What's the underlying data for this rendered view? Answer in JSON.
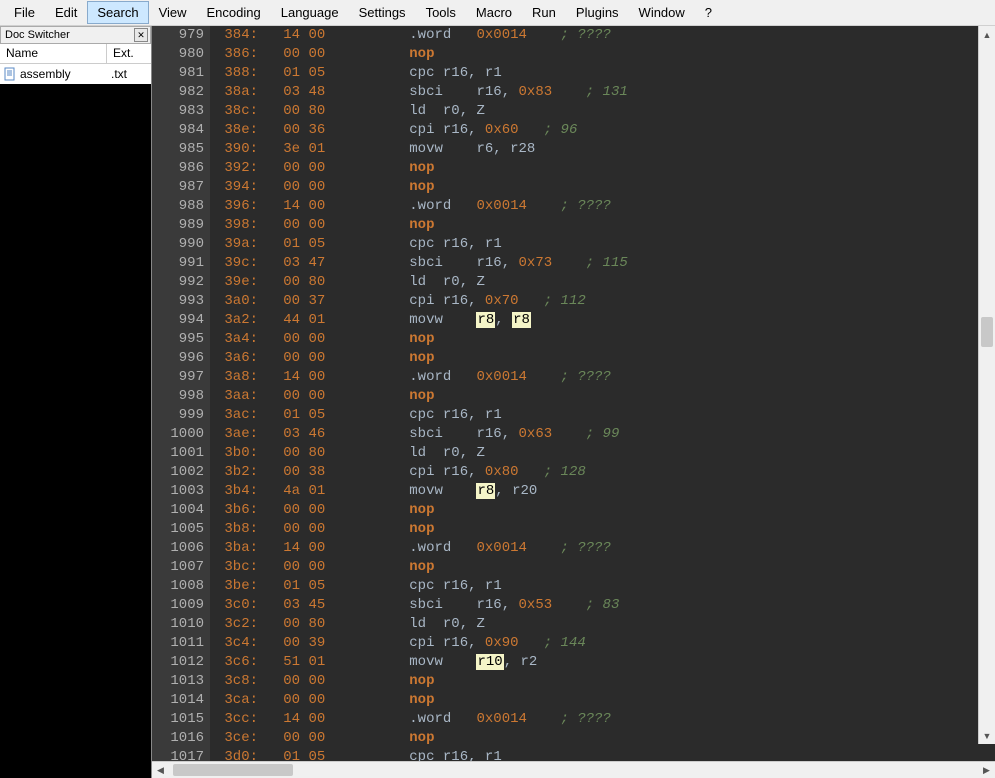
{
  "menu": [
    "File",
    "Edit",
    "Search",
    "View",
    "Encoding",
    "Language",
    "Settings",
    "Tools",
    "Macro",
    "Run",
    "Plugins",
    "Window",
    "?"
  ],
  "menu_active_index": 2,
  "doc_switcher": {
    "title": "Doc Switcher",
    "col_name": "Name",
    "col_ext": "Ext.",
    "files": [
      {
        "name": "assembly",
        "ext": ".txt"
      }
    ]
  },
  "rows": [
    {
      "ln": 979,
      "addr": "384",
      "b1": "14",
      "b2": "00",
      "instr": ".word",
      "a1": "0x0014",
      "comment": "; ????"
    },
    {
      "ln": 980,
      "addr": "386",
      "b1": "00",
      "b2": "00",
      "instr": "nop"
    },
    {
      "ln": 981,
      "addr": "388",
      "b1": "01",
      "b2": "05",
      "instr": "cpc",
      "a1": "r16,",
      "a2": "r1"
    },
    {
      "ln": 982,
      "addr": "38a",
      "b1": "03",
      "b2": "48",
      "instr": "sbci",
      "a1": "r16,",
      "a2": "0x83",
      "comment": "; 131"
    },
    {
      "ln": 983,
      "addr": "38c",
      "b1": "00",
      "b2": "80",
      "instr": "ld",
      "a1": "r0,",
      "a2": "Z"
    },
    {
      "ln": 984,
      "addr": "38e",
      "b1": "00",
      "b2": "36",
      "instr": "cpi",
      "a1": "r16,",
      "a2": "0x60",
      "comment": "; 96"
    },
    {
      "ln": 985,
      "addr": "390",
      "b1": "3e",
      "b2": "01",
      "instr": "movw",
      "a1": "r6,",
      "a2": "r28"
    },
    {
      "ln": 986,
      "addr": "392",
      "b1": "00",
      "b2": "00",
      "instr": "nop"
    },
    {
      "ln": 987,
      "addr": "394",
      "b1": "00",
      "b2": "00",
      "instr": "nop"
    },
    {
      "ln": 988,
      "addr": "396",
      "b1": "14",
      "b2": "00",
      "instr": ".word",
      "a1": "0x0014",
      "comment": "; ????"
    },
    {
      "ln": 989,
      "addr": "398",
      "b1": "00",
      "b2": "00",
      "instr": "nop"
    },
    {
      "ln": 990,
      "addr": "39a",
      "b1": "01",
      "b2": "05",
      "instr": "cpc",
      "a1": "r16,",
      "a2": "r1"
    },
    {
      "ln": 991,
      "addr": "39c",
      "b1": "03",
      "b2": "47",
      "instr": "sbci",
      "a1": "r16,",
      "a2": "0x73",
      "comment": "; 115"
    },
    {
      "ln": 992,
      "addr": "39e",
      "b1": "00",
      "b2": "80",
      "instr": "ld",
      "a1": "r0,",
      "a2": "Z"
    },
    {
      "ln": 993,
      "addr": "3a0",
      "b1": "00",
      "b2": "37",
      "instr": "cpi",
      "a1": "r16,",
      "a2": "0x70",
      "comment": "; 112"
    },
    {
      "ln": 994,
      "addr": "3a2",
      "b1": "44",
      "b2": "01",
      "instr": "movw",
      "a1": "r8,",
      "a2": "r8",
      "sel": [
        1,
        2
      ]
    },
    {
      "ln": 995,
      "addr": "3a4",
      "b1": "00",
      "b2": "00",
      "instr": "nop"
    },
    {
      "ln": 996,
      "addr": "3a6",
      "b1": "00",
      "b2": "00",
      "instr": "nop"
    },
    {
      "ln": 997,
      "addr": "3a8",
      "b1": "14",
      "b2": "00",
      "instr": ".word",
      "a1": "0x0014",
      "comment": "; ????"
    },
    {
      "ln": 998,
      "addr": "3aa",
      "b1": "00",
      "b2": "00",
      "instr": "nop"
    },
    {
      "ln": 999,
      "addr": "3ac",
      "b1": "01",
      "b2": "05",
      "instr": "cpc",
      "a1": "r16,",
      "a2": "r1"
    },
    {
      "ln": 1000,
      "addr": "3ae",
      "b1": "03",
      "b2": "46",
      "instr": "sbci",
      "a1": "r16,",
      "a2": "0x63",
      "comment": "; 99"
    },
    {
      "ln": 1001,
      "addr": "3b0",
      "b1": "00",
      "b2": "80",
      "instr": "ld",
      "a1": "r0,",
      "a2": "Z"
    },
    {
      "ln": 1002,
      "addr": "3b2",
      "b1": "00",
      "b2": "38",
      "instr": "cpi",
      "a1": "r16,",
      "a2": "0x80",
      "comment": "; 128"
    },
    {
      "ln": 1003,
      "addr": "3b4",
      "b1": "4a",
      "b2": "01",
      "instr": "movw",
      "a1": "r8,",
      "a2": "r20",
      "sel": [
        1
      ]
    },
    {
      "ln": 1004,
      "addr": "3b6",
      "b1": "00",
      "b2": "00",
      "instr": "nop"
    },
    {
      "ln": 1005,
      "addr": "3b8",
      "b1": "00",
      "b2": "00",
      "instr": "nop"
    },
    {
      "ln": 1006,
      "addr": "3ba",
      "b1": "14",
      "b2": "00",
      "instr": ".word",
      "a1": "0x0014",
      "comment": "; ????"
    },
    {
      "ln": 1007,
      "addr": "3bc",
      "b1": "00",
      "b2": "00",
      "instr": "nop"
    },
    {
      "ln": 1008,
      "addr": "3be",
      "b1": "01",
      "b2": "05",
      "instr": "cpc",
      "a1": "r16,",
      "a2": "r1"
    },
    {
      "ln": 1009,
      "addr": "3c0",
      "b1": "03",
      "b2": "45",
      "instr": "sbci",
      "a1": "r16,",
      "a2": "0x53",
      "comment": "; 83"
    },
    {
      "ln": 1010,
      "addr": "3c2",
      "b1": "00",
      "b2": "80",
      "instr": "ld",
      "a1": "r0,",
      "a2": "Z"
    },
    {
      "ln": 1011,
      "addr": "3c4",
      "b1": "00",
      "b2": "39",
      "instr": "cpi",
      "a1": "r16,",
      "a2": "0x90",
      "comment": "; 144"
    },
    {
      "ln": 1012,
      "addr": "3c6",
      "b1": "51",
      "b2": "01",
      "instr": "movw",
      "a1": "r10,",
      "a2": "r2",
      "sel": [
        1
      ]
    },
    {
      "ln": 1013,
      "addr": "3c8",
      "b1": "00",
      "b2": "00",
      "instr": "nop"
    },
    {
      "ln": 1014,
      "addr": "3ca",
      "b1": "00",
      "b2": "00",
      "instr": "nop"
    },
    {
      "ln": 1015,
      "addr": "3cc",
      "b1": "14",
      "b2": "00",
      "instr": ".word",
      "a1": "0x0014",
      "comment": "; ????"
    },
    {
      "ln": 1016,
      "addr": "3ce",
      "b1": "00",
      "b2": "00",
      "instr": "nop"
    },
    {
      "ln": 1017,
      "addr": "3d0",
      "b1": "01",
      "b2": "05",
      "instr": "cpc",
      "a1": "r16,",
      "a2": "r1"
    }
  ]
}
